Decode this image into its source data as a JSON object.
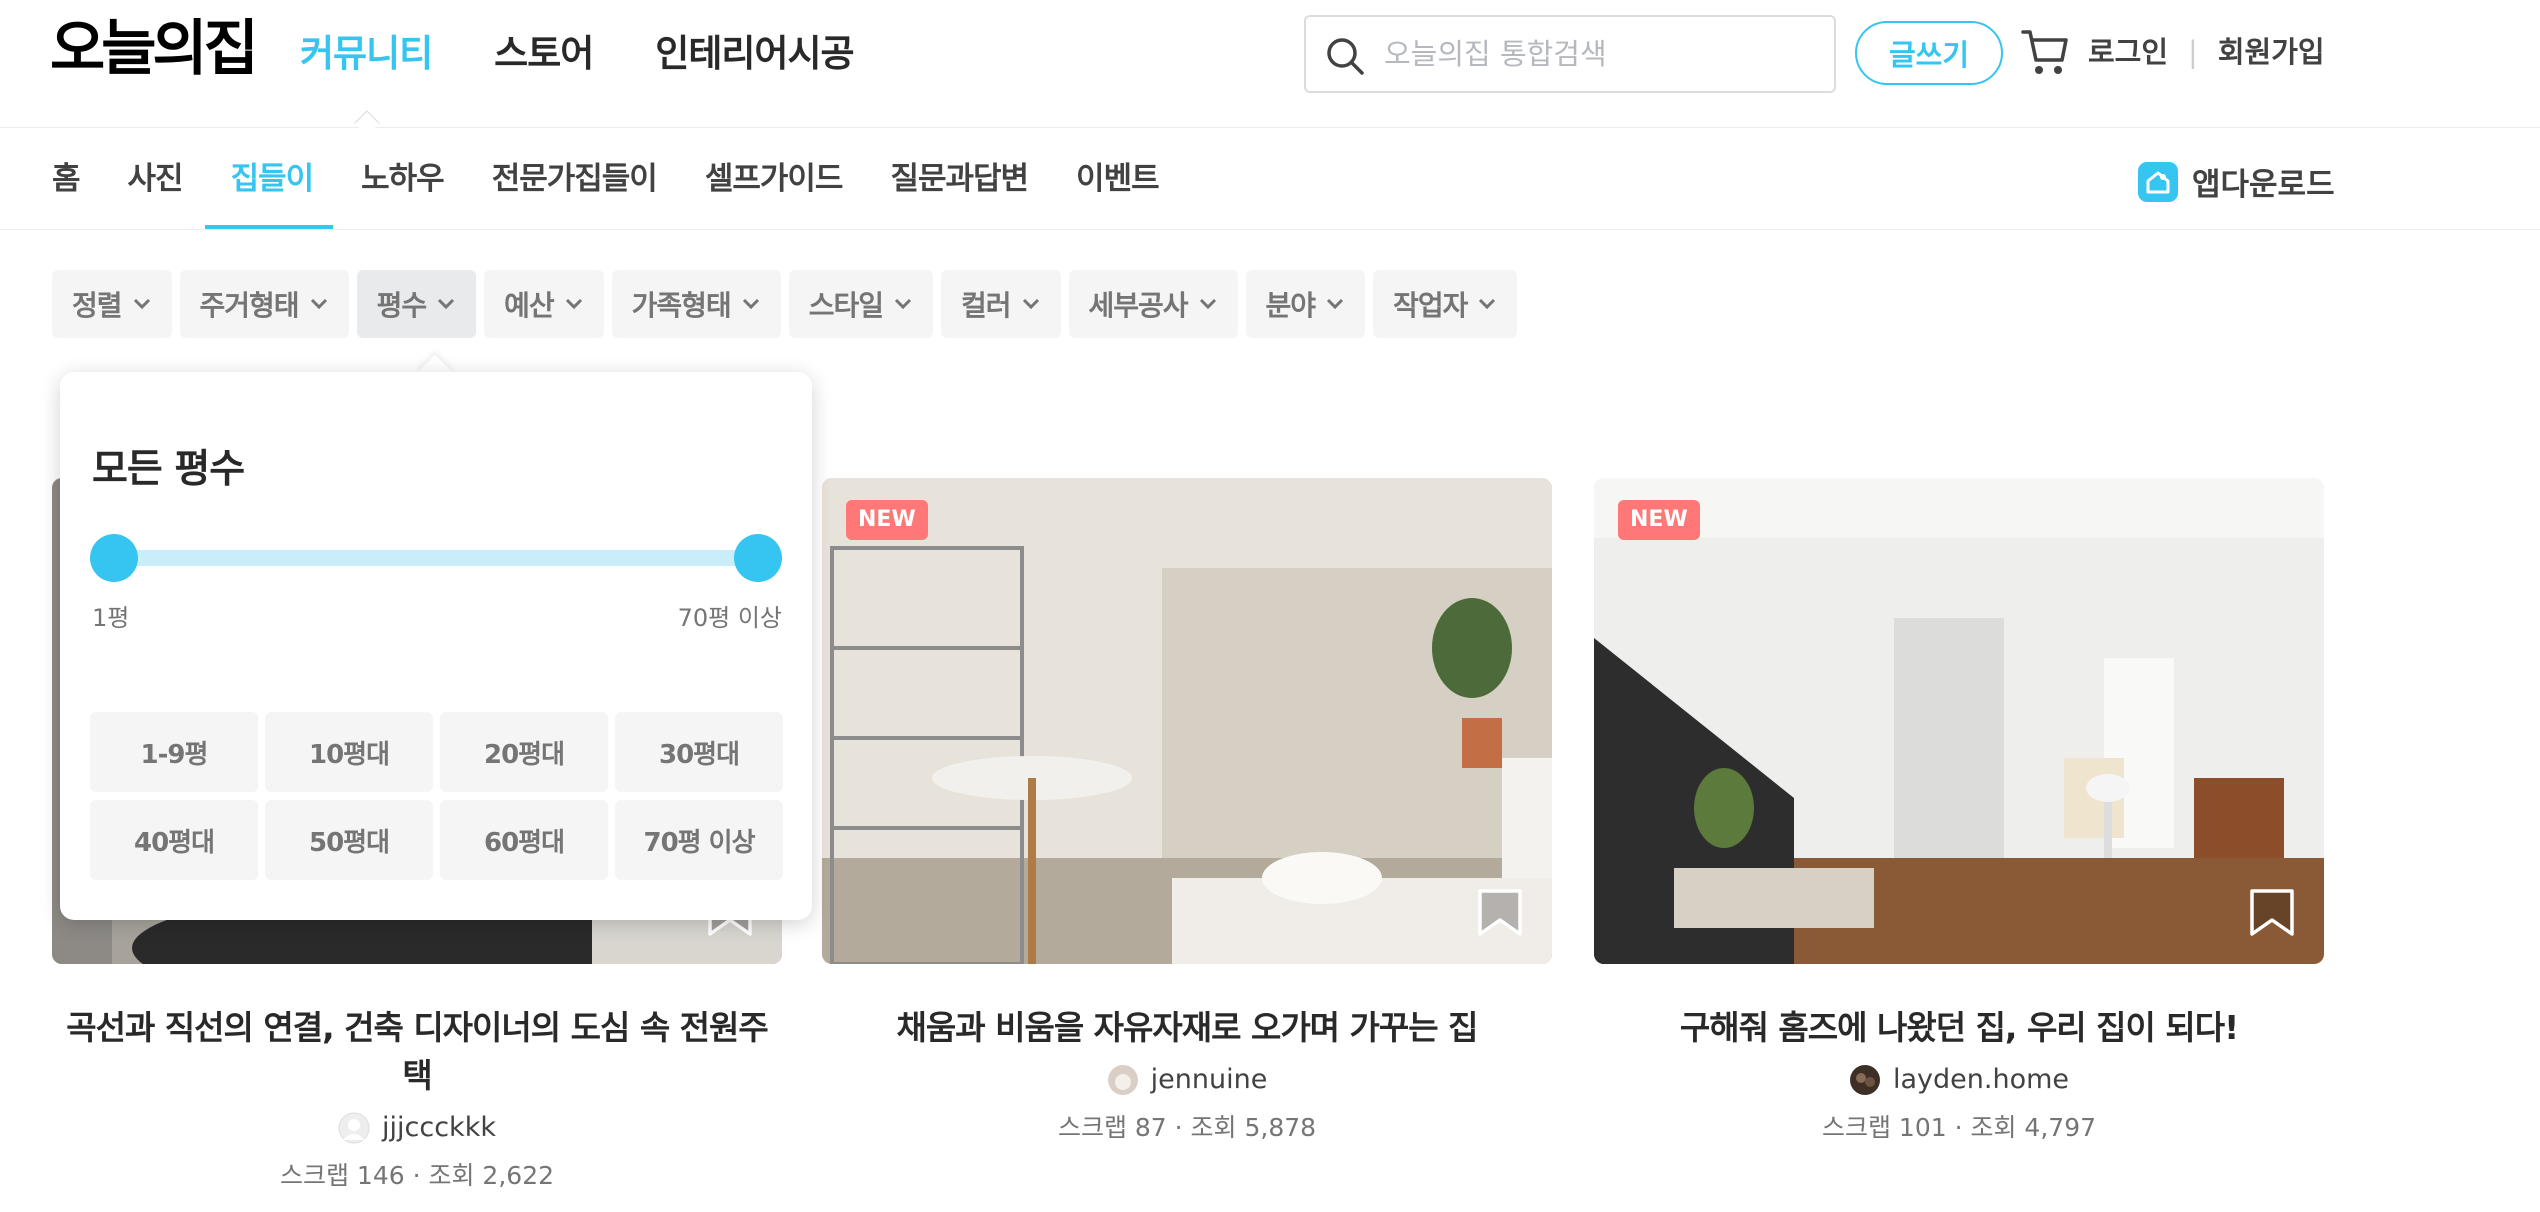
{
  "header": {
    "logo": "오늘의집",
    "nav": [
      {
        "label": "커뮤니티",
        "active": true
      },
      {
        "label": "스토어",
        "active": false
      },
      {
        "label": "인테리어시공",
        "active": false
      }
    ],
    "search_placeholder": "오늘의집 통합검색",
    "write_label": "글쓰기",
    "login_label": "로그인",
    "signup_label": "회원가입",
    "accent_color": "#35c5f0"
  },
  "subnav": {
    "items": [
      {
        "label": "홈",
        "active": false
      },
      {
        "label": "사진",
        "active": false
      },
      {
        "label": "집들이",
        "active": true
      },
      {
        "label": "노하우",
        "active": false
      },
      {
        "label": "전문가집들이",
        "active": false
      },
      {
        "label": "셀프가이드",
        "active": false
      },
      {
        "label": "질문과답변",
        "active": false
      },
      {
        "label": "이벤트",
        "active": false
      }
    ],
    "app_download_label": "앱다운로드"
  },
  "filters": [
    {
      "label": "정렬",
      "open": false
    },
    {
      "label": "주거형태",
      "open": false
    },
    {
      "label": "평수",
      "open": true
    },
    {
      "label": "예산",
      "open": false
    },
    {
      "label": "가족형태",
      "open": false
    },
    {
      "label": "스타일",
      "open": false
    },
    {
      "label": "컬러",
      "open": false
    },
    {
      "label": "세부공사",
      "open": false
    },
    {
      "label": "분야",
      "open": false
    },
    {
      "label": "작업자",
      "open": false
    }
  ],
  "size_popup": {
    "title": "모든 평수",
    "range_min_label": "1평",
    "range_max_label": "70평 이상",
    "options": [
      "1-9평",
      "10평대",
      "20평대",
      "30평대",
      "40평대",
      "50평대",
      "60평대",
      "70평 이상"
    ]
  },
  "cards": [
    {
      "title": "곡선과 직선의 연결, 건축 디자이너의 도심 속 전원주택",
      "author": "jjjccckkk",
      "stats": "스크랩 146 · 조회 2,622",
      "is_new": false,
      "new_label": ""
    },
    {
      "title": "채움과 비움을 자유자재로 오가며 가꾸는 집",
      "author": "jennuine",
      "stats": "스크랩 87 · 조회 5,878",
      "is_new": true,
      "new_label": "NEW"
    },
    {
      "title": "구해줘 홈즈에 나왔던 집, 우리 집이 되다!",
      "author": "layden.home",
      "stats": "스크랩 101 · 조회 4,797",
      "is_new": true,
      "new_label": "NEW"
    }
  ]
}
